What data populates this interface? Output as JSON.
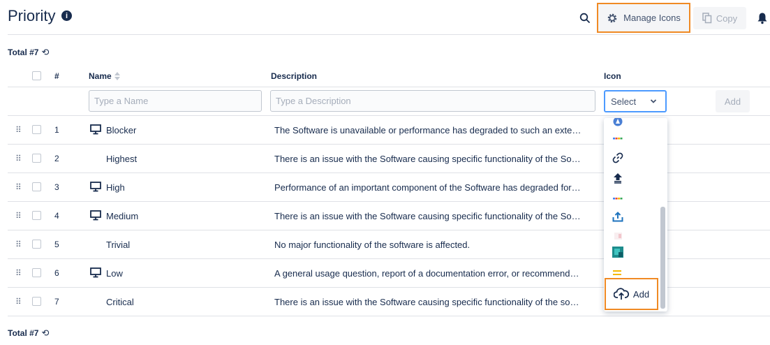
{
  "header": {
    "title": "Priority",
    "manage_icons_label": "Manage Icons",
    "copy_label": "Copy"
  },
  "total_label_top": "Total #7",
  "total_label_bottom": "Total #7",
  "table": {
    "columns": {
      "num": "#",
      "name": "Name",
      "description": "Description",
      "icon": "Icon"
    },
    "new_row": {
      "name_placeholder": "Type a Name",
      "description_placeholder": "Type a Description",
      "icon_select_value": "Select",
      "add_label": "Add"
    },
    "rows": [
      {
        "num": "1",
        "name": "Blocker",
        "has_icon": true,
        "description": "The Software is unavailable or performance has degraded to such an extent that the Software is unusable"
      },
      {
        "num": "2",
        "name": "Highest",
        "has_icon": false,
        "description": "There is an issue with the Software causing specific functionality of the Software to be unavailable"
      },
      {
        "num": "3",
        "name": "High",
        "has_icon": true,
        "description": "Performance of an important component of the Software has degraded for all users"
      },
      {
        "num": "4",
        "name": "Medium",
        "has_icon": true,
        "description": "There is an issue with the Software causing specific functionality of the Software to be impaired"
      },
      {
        "num": "5",
        "name": "Trivial",
        "has_icon": false,
        "description": "No major functionality of the software is affected."
      },
      {
        "num": "6",
        "name": "Low",
        "has_icon": true,
        "description": "A general usage question, report of a documentation error, or recommendation for improvement"
      },
      {
        "num": "7",
        "name": "Critical",
        "has_icon": false,
        "description": "There is an issue with the Software causing specific functionality of the software to fail"
      }
    ]
  },
  "icon_dropdown": {
    "items": [
      "round-blue-icon",
      "google-icon",
      "link-icon",
      "upload-arrow-icon",
      "google-icon",
      "cloud-upload-blue-icon",
      "pink-image-icon",
      "teal-image-icon",
      "yellow-lines-icon"
    ],
    "add_label": "Add"
  },
  "colors": {
    "accent_orange": "#f08a24",
    "focus_blue": "#4c9aff",
    "text": "#172b4d"
  }
}
